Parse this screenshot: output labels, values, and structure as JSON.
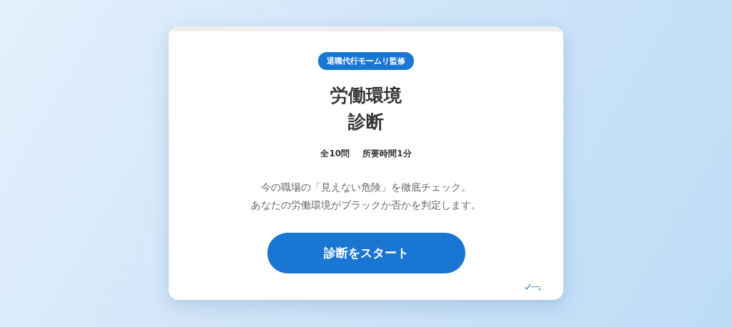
{
  "progress": {
    "level": 0
  },
  "badge": "退職代行モームリ監修",
  "title_lines": [
    "労働環境",
    "診断"
  ],
  "meta": [
    "全10問",
    "所要時間1分"
  ],
  "description_lines": [
    "今の職場の「見えない危険」を徹底チェック。",
    "あなたの労働環境がブラックか否かを判定します。"
  ],
  "start_button": "診断をスタート"
}
